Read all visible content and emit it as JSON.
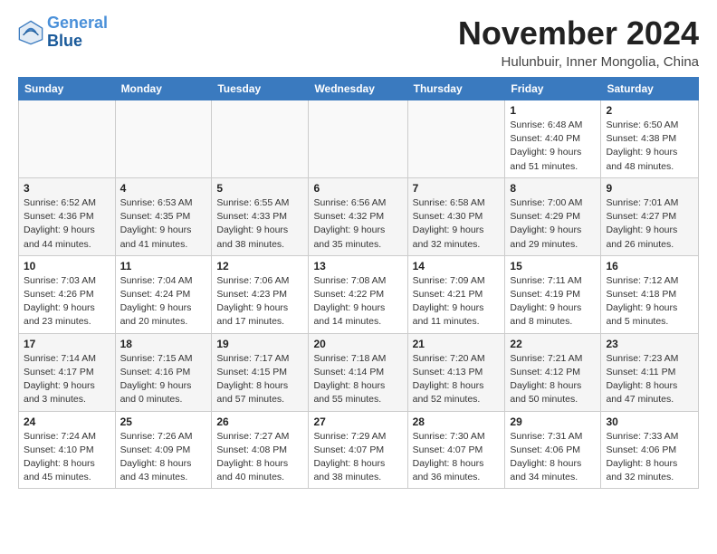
{
  "header": {
    "logo_line1": "General",
    "logo_line2": "Blue",
    "month": "November 2024",
    "location": "Hulunbuir, Inner Mongolia, China"
  },
  "weekdays": [
    "Sunday",
    "Monday",
    "Tuesday",
    "Wednesday",
    "Thursday",
    "Friday",
    "Saturday"
  ],
  "weeks": [
    [
      {
        "day": "",
        "info": ""
      },
      {
        "day": "",
        "info": ""
      },
      {
        "day": "",
        "info": ""
      },
      {
        "day": "",
        "info": ""
      },
      {
        "day": "",
        "info": ""
      },
      {
        "day": "1",
        "info": "Sunrise: 6:48 AM\nSunset: 4:40 PM\nDaylight: 9 hours and 51 minutes."
      },
      {
        "day": "2",
        "info": "Sunrise: 6:50 AM\nSunset: 4:38 PM\nDaylight: 9 hours and 48 minutes."
      }
    ],
    [
      {
        "day": "3",
        "info": "Sunrise: 6:52 AM\nSunset: 4:36 PM\nDaylight: 9 hours and 44 minutes."
      },
      {
        "day": "4",
        "info": "Sunrise: 6:53 AM\nSunset: 4:35 PM\nDaylight: 9 hours and 41 minutes."
      },
      {
        "day": "5",
        "info": "Sunrise: 6:55 AM\nSunset: 4:33 PM\nDaylight: 9 hours and 38 minutes."
      },
      {
        "day": "6",
        "info": "Sunrise: 6:56 AM\nSunset: 4:32 PM\nDaylight: 9 hours and 35 minutes."
      },
      {
        "day": "7",
        "info": "Sunrise: 6:58 AM\nSunset: 4:30 PM\nDaylight: 9 hours and 32 minutes."
      },
      {
        "day": "8",
        "info": "Sunrise: 7:00 AM\nSunset: 4:29 PM\nDaylight: 9 hours and 29 minutes."
      },
      {
        "day": "9",
        "info": "Sunrise: 7:01 AM\nSunset: 4:27 PM\nDaylight: 9 hours and 26 minutes."
      }
    ],
    [
      {
        "day": "10",
        "info": "Sunrise: 7:03 AM\nSunset: 4:26 PM\nDaylight: 9 hours and 23 minutes."
      },
      {
        "day": "11",
        "info": "Sunrise: 7:04 AM\nSunset: 4:24 PM\nDaylight: 9 hours and 20 minutes."
      },
      {
        "day": "12",
        "info": "Sunrise: 7:06 AM\nSunset: 4:23 PM\nDaylight: 9 hours and 17 minutes."
      },
      {
        "day": "13",
        "info": "Sunrise: 7:08 AM\nSunset: 4:22 PM\nDaylight: 9 hours and 14 minutes."
      },
      {
        "day": "14",
        "info": "Sunrise: 7:09 AM\nSunset: 4:21 PM\nDaylight: 9 hours and 11 minutes."
      },
      {
        "day": "15",
        "info": "Sunrise: 7:11 AM\nSunset: 4:19 PM\nDaylight: 9 hours and 8 minutes."
      },
      {
        "day": "16",
        "info": "Sunrise: 7:12 AM\nSunset: 4:18 PM\nDaylight: 9 hours and 5 minutes."
      }
    ],
    [
      {
        "day": "17",
        "info": "Sunrise: 7:14 AM\nSunset: 4:17 PM\nDaylight: 9 hours and 3 minutes."
      },
      {
        "day": "18",
        "info": "Sunrise: 7:15 AM\nSunset: 4:16 PM\nDaylight: 9 hours and 0 minutes."
      },
      {
        "day": "19",
        "info": "Sunrise: 7:17 AM\nSunset: 4:15 PM\nDaylight: 8 hours and 57 minutes."
      },
      {
        "day": "20",
        "info": "Sunrise: 7:18 AM\nSunset: 4:14 PM\nDaylight: 8 hours and 55 minutes."
      },
      {
        "day": "21",
        "info": "Sunrise: 7:20 AM\nSunset: 4:13 PM\nDaylight: 8 hours and 52 minutes."
      },
      {
        "day": "22",
        "info": "Sunrise: 7:21 AM\nSunset: 4:12 PM\nDaylight: 8 hours and 50 minutes."
      },
      {
        "day": "23",
        "info": "Sunrise: 7:23 AM\nSunset: 4:11 PM\nDaylight: 8 hours and 47 minutes."
      }
    ],
    [
      {
        "day": "24",
        "info": "Sunrise: 7:24 AM\nSunset: 4:10 PM\nDaylight: 8 hours and 45 minutes."
      },
      {
        "day": "25",
        "info": "Sunrise: 7:26 AM\nSunset: 4:09 PM\nDaylight: 8 hours and 43 minutes."
      },
      {
        "day": "26",
        "info": "Sunrise: 7:27 AM\nSunset: 4:08 PM\nDaylight: 8 hours and 40 minutes."
      },
      {
        "day": "27",
        "info": "Sunrise: 7:29 AM\nSunset: 4:07 PM\nDaylight: 8 hours and 38 minutes."
      },
      {
        "day": "28",
        "info": "Sunrise: 7:30 AM\nSunset: 4:07 PM\nDaylight: 8 hours and 36 minutes."
      },
      {
        "day": "29",
        "info": "Sunrise: 7:31 AM\nSunset: 4:06 PM\nDaylight: 8 hours and 34 minutes."
      },
      {
        "day": "30",
        "info": "Sunrise: 7:33 AM\nSunset: 4:06 PM\nDaylight: 8 hours and 32 minutes."
      }
    ]
  ]
}
